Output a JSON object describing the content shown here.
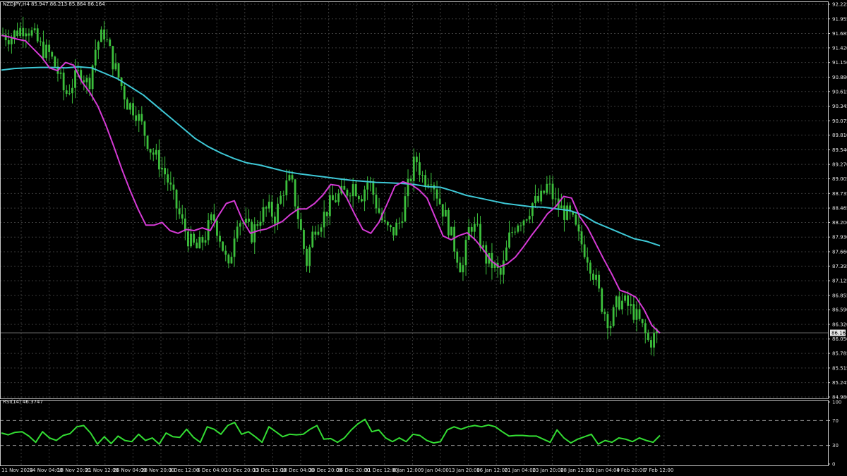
{
  "window": {
    "symbol_info": "NZDJPY,H4  85.947 86.213 85.864 86.164",
    "current_price_label": "86.164"
  },
  "colors": {
    "background": "#000000",
    "grid": "#3a3a3a",
    "candle": "#3cbf3c",
    "ma_fast": "#d63ad6",
    "ma_slow": "#3ec8d6",
    "rsi": "#33dd33",
    "axis_text": "#e6e6e6",
    "border": "#c8c8c8"
  },
  "chart_data": [
    {
      "type": "line",
      "title": "NZDJPY,H4  85.947 86.213 85.864 86.164",
      "x_ticks": [
        "11 Nov 2024",
        "14 Nov 04:00",
        "18 Nov 20:00",
        "21 Nov 12:00",
        "26 Nov 04:00",
        "28 Nov 20:00",
        "3 Dec 12:00",
        "6 Dec 04:00",
        "10 Dec 20:00",
        "13 Dec 12:00",
        "18 Dec 04:00",
        "20 Dec 20:00",
        "26 Dec 20:00",
        "31 Dec 12:00",
        "6 Jan 12:00",
        "9 Jan 04:00",
        "13 Jan 20:00",
        "16 Jan 12:00",
        "21 Jan 04:00",
        "23 Jan 20:00",
        "28 Jan 12:00",
        "31 Jan 04:00",
        "4 Feb 20:00",
        "7 Feb 12:00"
      ],
      "y_ticks": [
        "92.225",
        "91.955",
        "91.685",
        "91.420",
        "91.150",
        "90.880",
        "90.615",
        "90.345",
        "90.075",
        "89.810",
        "89.540",
        "89.270",
        "89.005",
        "88.735",
        "88.465",
        "88.200",
        "87.930",
        "87.660",
        "87.395",
        "87.125",
        "86.855",
        "86.590",
        "86.320",
        "86.050",
        "85.785",
        "85.515",
        "85.245",
        "84.980"
      ],
      "ylim": [
        84.98,
        92.225
      ],
      "current_price": 86.164,
      "grid": true,
      "series": [
        {
          "kind": "price",
          "values": [
            91.67,
            91.62,
            91.75,
            91.82,
            91.63,
            91.4,
            91.3,
            91.0,
            90.55,
            90.78,
            91.0,
            90.72,
            91.48,
            91.7,
            91.22,
            90.82,
            90.4,
            90.28,
            89.93,
            89.54,
            89.33,
            89.05,
            88.6,
            88.2,
            87.84,
            87.7,
            87.96,
            88.32,
            87.88,
            87.3,
            88.3,
            88.18,
            87.97,
            88.32,
            88.45,
            88.3,
            88.82,
            88.98,
            88.25,
            87.45,
            88.13,
            88.27,
            88.53,
            88.68,
            88.75,
            88.9,
            88.7,
            89.0,
            88.52,
            88.12,
            88.0,
            88.21,
            88.82,
            89.4,
            89.0,
            89.07,
            88.62,
            88.25,
            87.75,
            87.3,
            88.2,
            88.0,
            87.54,
            87.4,
            87.2,
            87.9,
            88.22,
            88.3,
            88.55,
            88.6,
            88.9,
            88.55,
            88.4,
            88.28,
            87.9,
            87.62,
            87.2,
            86.65,
            86.32,
            86.76,
            86.7,
            86.55,
            86.3,
            85.97,
            86.16
          ]
        },
        {
          "kind": "ma_fast",
          "values": [
            91.65,
            91.62,
            91.58,
            91.55,
            91.4,
            91.25,
            91.05,
            91.0,
            91.15,
            91.1,
            90.8,
            90.6,
            90.35,
            90.0,
            89.6,
            89.18,
            88.8,
            88.45,
            88.15,
            88.15,
            88.2,
            88.05,
            88.0,
            88.07,
            88.05,
            88.1,
            88.05,
            88.32,
            88.55,
            88.6,
            88.25,
            88.0,
            88.05,
            88.08,
            88.15,
            88.22,
            88.35,
            88.45,
            88.45,
            88.55,
            88.7,
            88.9,
            88.88,
            88.65,
            88.35,
            88.07,
            88.0,
            88.2,
            88.53,
            88.87,
            88.95,
            88.9,
            88.8,
            88.65,
            88.3,
            87.95,
            87.88,
            87.96,
            88.01,
            87.88,
            87.7,
            87.49,
            87.38,
            87.44,
            87.56,
            87.75,
            87.96,
            88.15,
            88.36,
            88.49,
            88.68,
            88.65,
            88.31,
            88.1,
            87.81,
            87.52,
            87.25,
            86.95,
            86.9,
            86.82,
            86.6,
            86.3,
            86.16
          ]
        },
        {
          "kind": "ma_slow",
          "values": [
            91.01,
            91.04,
            91.05,
            91.06,
            91.06,
            91.05,
            91.07,
            91.05,
            90.95,
            90.85,
            90.7,
            90.55,
            90.35,
            90.15,
            89.95,
            89.75,
            89.6,
            89.48,
            89.38,
            89.3,
            89.26,
            89.2,
            89.14,
            89.1,
            89.07,
            89.04,
            89.01,
            88.98,
            88.96,
            88.94,
            88.93,
            88.92,
            88.9,
            88.86,
            88.85,
            88.78,
            88.7,
            88.65,
            88.6,
            88.55,
            88.52,
            88.49,
            88.48,
            88.45,
            88.42,
            88.34,
            88.2,
            88.1,
            88.0,
            87.9,
            87.85,
            87.77
          ]
        }
      ]
    },
    {
      "type": "line",
      "title": "RSI(14) 46.3747",
      "ylim": [
        0,
        100
      ],
      "y_ticks": [
        "100",
        "70",
        "30",
        "0"
      ],
      "levels": [
        70,
        30
      ],
      "series": [
        {
          "kind": "rsi",
          "values": [
            50,
            47,
            51,
            52,
            45,
            35,
            52,
            42,
            38,
            46,
            49,
            60,
            62,
            50,
            32,
            44,
            33,
            45,
            38,
            36,
            48,
            38,
            42,
            32,
            50,
            44,
            43,
            56,
            43,
            35,
            60,
            56,
            48,
            62,
            67,
            48,
            52,
            44,
            35,
            60,
            52,
            44,
            48,
            47,
            48,
            56,
            62,
            40,
            41,
            35,
            42,
            55,
            65,
            72,
            52,
            55,
            42,
            36,
            42,
            36,
            48,
            46,
            38,
            34,
            36,
            55,
            60,
            56,
            60,
            62,
            60,
            63,
            60,
            52,
            45,
            46,
            46,
            45,
            45,
            40,
            35,
            55,
            42,
            34,
            40,
            44,
            48,
            32,
            38,
            35,
            42,
            40,
            36,
            42,
            38,
            35,
            46
          ]
        }
      ]
    }
  ]
}
